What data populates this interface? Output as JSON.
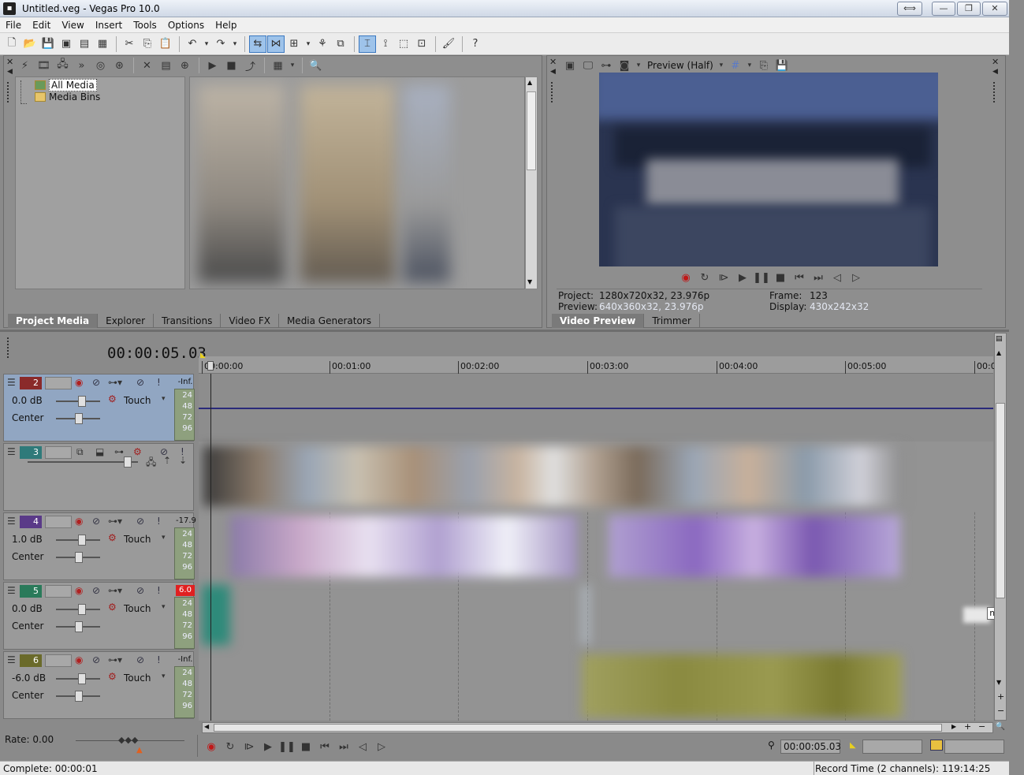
{
  "window": {
    "title": "Untitled.veg - Vegas Pro 10.0",
    "buttons": {
      "resize": "⟺",
      "minimize": "—",
      "restore": "❐",
      "close": "✕"
    }
  },
  "menu": [
    "File",
    "Edit",
    "View",
    "Insert",
    "Tools",
    "Options",
    "Help"
  ],
  "media": {
    "tree": {
      "all_media": "All Media",
      "media_bins": "Media Bins"
    },
    "tabs": [
      "Project Media",
      "Explorer",
      "Transitions",
      "Video FX",
      "Media Generators"
    ]
  },
  "preview": {
    "mode": "Preview (Half)",
    "project_label": "Project:",
    "project_value": "1280x720x32, 23.976p",
    "preview_label": "Preview:",
    "preview_value": "640x360x32, 23.976p",
    "frame_label": "Frame:",
    "frame_value": "123",
    "display_label": "Display:",
    "display_value": "430x242x32",
    "tabs": [
      "Video Preview",
      "Trimmer"
    ]
  },
  "timeline": {
    "timecode": "00:00:05.03",
    "ruler": [
      "00:00:00",
      "00:01:00",
      "00:02:00",
      "00:03:00",
      "00:04:00",
      "00:05:00",
      "00:0"
    ],
    "tracks": [
      {
        "num": "2",
        "color": "#8a2a2a",
        "vol": "0.0 dB",
        "pan": "Center",
        "peak": "-Inf.",
        "mode": "Touch",
        "selected": true
      },
      {
        "num": "3",
        "color": "#2f7a7a",
        "video": true
      },
      {
        "num": "4",
        "color": "#5a3a88",
        "vol": "1.0 dB",
        "pan": "Center",
        "peak": "-17.9",
        "mode": "Touch"
      },
      {
        "num": "5",
        "color": "#2a7a5a",
        "vol": "0.0 dB",
        "pan": "Center",
        "peak": "6.0",
        "mode": "Touch",
        "peak_red": true
      },
      {
        "num": "6",
        "color": "#6a6a2a",
        "vol": "-6.0 dB",
        "pan": "Center",
        "peak": "-Inf.",
        "mode": "Touch"
      }
    ],
    "meter_labels": [
      "24",
      "48",
      "72",
      "96"
    ],
    "tooltip_fragment": "me"
  },
  "bottom": {
    "rate": "Rate: 0.00",
    "cursor_time": "00:00:05.03"
  },
  "status": {
    "complete": "Complete: 00:00:01",
    "record_time": "Record Time (2 channels): 119:14:25"
  }
}
